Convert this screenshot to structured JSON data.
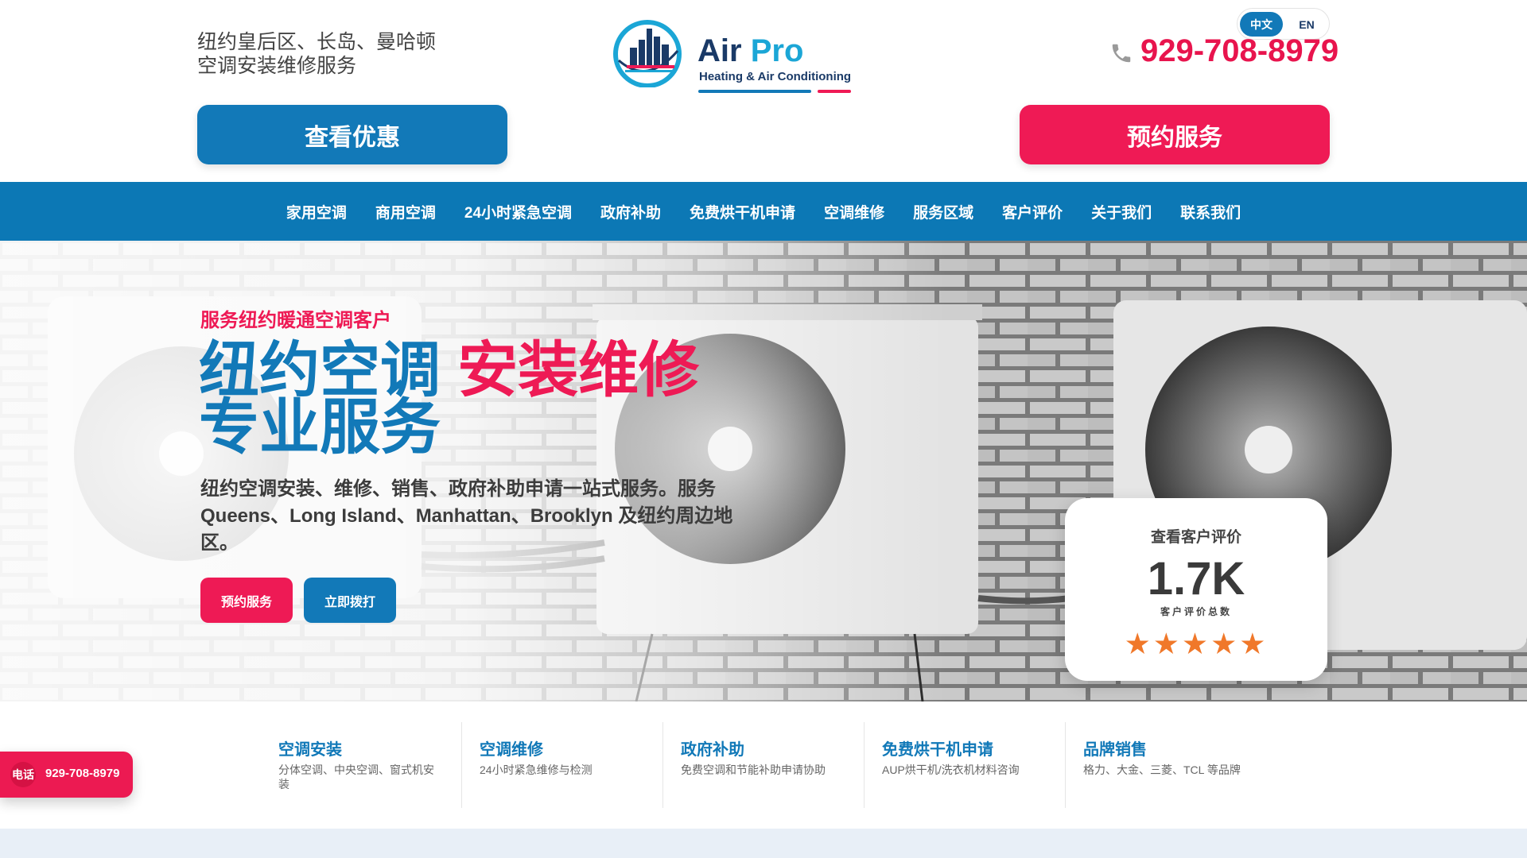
{
  "header": {
    "tagline_line1": "纽约皇后区、长岛、曼哈顿",
    "tagline_line2": "空调安装维修服务",
    "offer_button": "查看优惠",
    "book_button": "预约服务",
    "logo": {
      "name_part1": "Air",
      "name_part2": "Pro",
      "subtitle": "Heating & Air Conditioning"
    },
    "lang": {
      "zh": "中文",
      "en": "EN",
      "active": "zh"
    },
    "phone": "929-708-8979",
    "colors": {
      "brand_blue": "#1279b8",
      "brand_red": "#ee1a55",
      "navy": "#1a3a67"
    }
  },
  "nav": {
    "items": [
      "家用空调",
      "商用空调",
      "24小时紧急空调",
      "政府补助",
      "免费烘干机申请",
      "空调维修",
      "服务区域",
      "客户评价",
      "关于我们",
      "联系我们"
    ]
  },
  "hero": {
    "eyebrow": "服务纽约暖通空调客户",
    "title_blue_1": "纽约空调",
    "title_red": "安装维修",
    "title_blue_2": "专业服务",
    "description": "纽约空调安装、维修、销售、政府补助申请一站式服务。服务 Queens、Long Island、Manhattan、Brooklyn 及纽约周边地区。",
    "book_button": "预约服务",
    "call_button": "立即拨打"
  },
  "review_card": {
    "heading": "查看客户评价",
    "count": "1.7K",
    "subtitle": "客户评价总数",
    "stars": "★★★★★",
    "rating": 5
  },
  "services": [
    {
      "title": "空调安装",
      "desc": "分体空调、中央空调、窗式机安装"
    },
    {
      "title": "空调维修",
      "desc": "24小时紧急维修与检测"
    },
    {
      "title": "政府补助",
      "desc": "免费空调和节能补助申请协助"
    },
    {
      "title": "免费烘干机申请",
      "desc": "AUP烘干机/洗衣机材料咨询"
    },
    {
      "title": "品牌销售",
      "desc": "格力、大金、三菱、TCL 等品牌"
    }
  ],
  "float_call": {
    "badge": "电话",
    "number": "929-708-8979"
  }
}
